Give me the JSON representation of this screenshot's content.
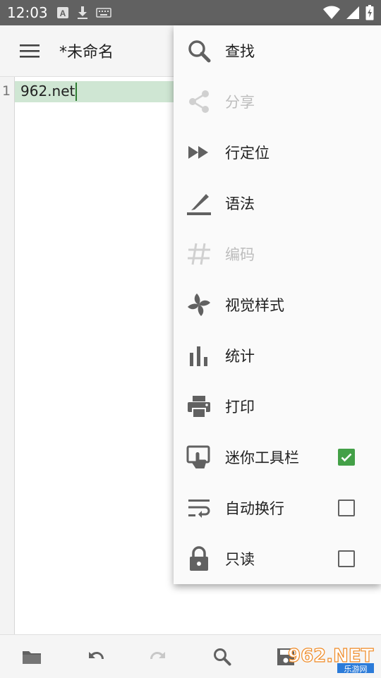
{
  "status_bar": {
    "time": "12:03",
    "icons": [
      "text-a-icon",
      "download-icon",
      "keyboard-icon",
      "wifi-icon",
      "signal-icon",
      "battery-charging-icon"
    ]
  },
  "app_bar": {
    "title": "*未命名",
    "menu_icon": "hamburger-icon"
  },
  "editor": {
    "line_numbers": [
      "1"
    ],
    "lines": [
      "962.net"
    ]
  },
  "overflow_menu": {
    "items": [
      {
        "label": "查找",
        "icon": "search-icon",
        "enabled": true
      },
      {
        "label": "分享",
        "icon": "share-icon",
        "enabled": false
      },
      {
        "label": "行定位",
        "icon": "fast-forward-icon",
        "enabled": true
      },
      {
        "label": "语法",
        "icon": "highlighter-icon",
        "enabled": true
      },
      {
        "label": "编码",
        "icon": "hash-icon",
        "enabled": false
      },
      {
        "label": "视觉样式",
        "icon": "pinwheel-icon",
        "enabled": true
      },
      {
        "label": "统计",
        "icon": "bar-chart-icon",
        "enabled": true
      },
      {
        "label": "打印",
        "icon": "printer-icon",
        "enabled": true
      },
      {
        "label": "迷你工具栏",
        "icon": "touch-screen-icon",
        "enabled": true,
        "checked": true
      },
      {
        "label": "自动换行",
        "icon": "wrap-text-icon",
        "enabled": true,
        "checked": false
      },
      {
        "label": "只读",
        "icon": "lock-icon",
        "enabled": true,
        "checked": false
      }
    ]
  },
  "bottom_bar": {
    "buttons": [
      "folder-icon",
      "undo-icon",
      "redo-icon",
      "search-icon",
      "save-icon"
    ]
  },
  "watermark": {
    "text": "962.NET",
    "subtext": "乐游网"
  },
  "colors": {
    "status_bar": "#616161",
    "accent_green": "#43a047",
    "current_line": "#cfe6d3",
    "disabled_text": "#bdbdbd",
    "icon_gray": "#616161"
  }
}
